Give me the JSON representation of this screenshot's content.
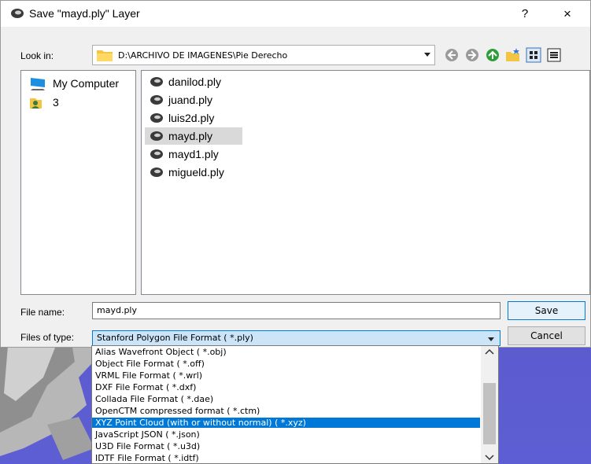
{
  "window": {
    "title": "Save \"mayd.ply\" Layer",
    "help": "?",
    "close": "×"
  },
  "look_in": {
    "label": "Look in:",
    "path": "D:\\ARCHIVO DE IMAGENES\\Pie Derecho"
  },
  "toolbar": {
    "icons": [
      "back-icon",
      "forward-icon",
      "up-folder-icon",
      "new-folder-icon",
      "list-view-icon",
      "detail-view-icon"
    ]
  },
  "places": [
    {
      "label": "My Computer",
      "icon": "computer-icon"
    },
    {
      "label": "3",
      "icon": "user-folder-icon"
    }
  ],
  "files": [
    {
      "name": "danilod.ply",
      "selected": false
    },
    {
      "name": "juand.ply",
      "selected": false
    },
    {
      "name": "luis2d.ply",
      "selected": false
    },
    {
      "name": "mayd.ply",
      "selected": true
    },
    {
      "name": "mayd1.ply",
      "selected": false
    },
    {
      "name": "migueld.ply",
      "selected": false
    }
  ],
  "file_name": {
    "label": "File name:",
    "value": "mayd.ply"
  },
  "file_type": {
    "label": "Files of type:",
    "selected": "Stanford Polygon File Format ( *.ply)",
    "options": [
      "Alias Wavefront Object ( *.obj)",
      "Object File Format ( *.off)",
      "VRML File Format ( *.wrl)",
      "DXF File Format ( *.dxf)",
      "Collada File Format ( *.dae)",
      "OpenCTM compressed format ( *.ctm)",
      "XYZ Point Cloud (with or without normal) ( *.xyz)",
      "JavaScript JSON ( *.json)",
      "U3D File Format ( *.u3d)",
      "IDTF File Format ( *.idtf)"
    ],
    "highlighted_index": 6
  },
  "buttons": {
    "save": "Save",
    "cancel": "Cancel"
  },
  "colors": {
    "accent": "#0078d7",
    "viewport": "#5a5ac8"
  }
}
